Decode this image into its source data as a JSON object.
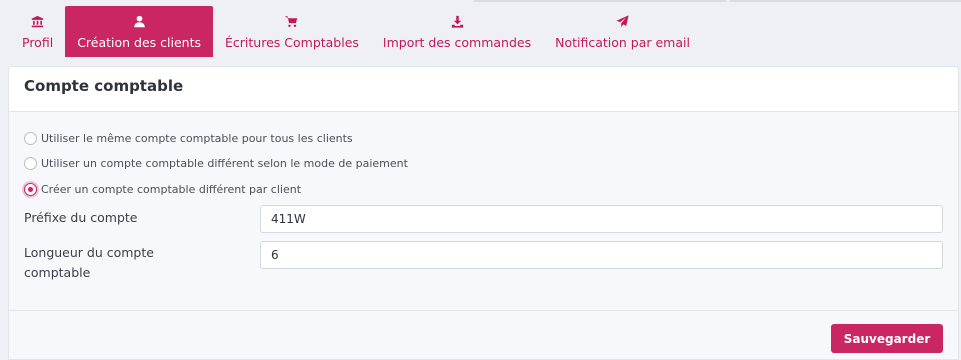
{
  "tabs": [
    {
      "label": "Profil",
      "icon": "bank-icon",
      "active": false
    },
    {
      "label": "Création des clients",
      "icon": "user-icon",
      "active": true
    },
    {
      "label": "Écritures Comptables",
      "icon": "cart-icon",
      "active": false
    },
    {
      "label": "Import des commandes",
      "icon": "download-icon",
      "active": false
    },
    {
      "label": "Notification par email",
      "icon": "paper-plane-icon",
      "active": false
    }
  ],
  "card": {
    "title": "Compte comptable",
    "options": [
      {
        "label": "Utiliser le même compte comptable pour tous les clients",
        "checked": false
      },
      {
        "label": "Utiliser un compte comptable différent selon le mode de paiement",
        "checked": false
      },
      {
        "label": "Créer un compte comptable différent par client",
        "checked": true
      }
    ],
    "prefix_label": "Préfixe du compte",
    "prefix_value": "411W",
    "length_label_line1": "Longueur du compte",
    "length_label_line2": "comptable",
    "length_value": "6",
    "save_label": "Sauvegarder"
  },
  "colors": {
    "accent": "#c92663",
    "background": "#eef0f5",
    "card": "#f7f8fb"
  }
}
